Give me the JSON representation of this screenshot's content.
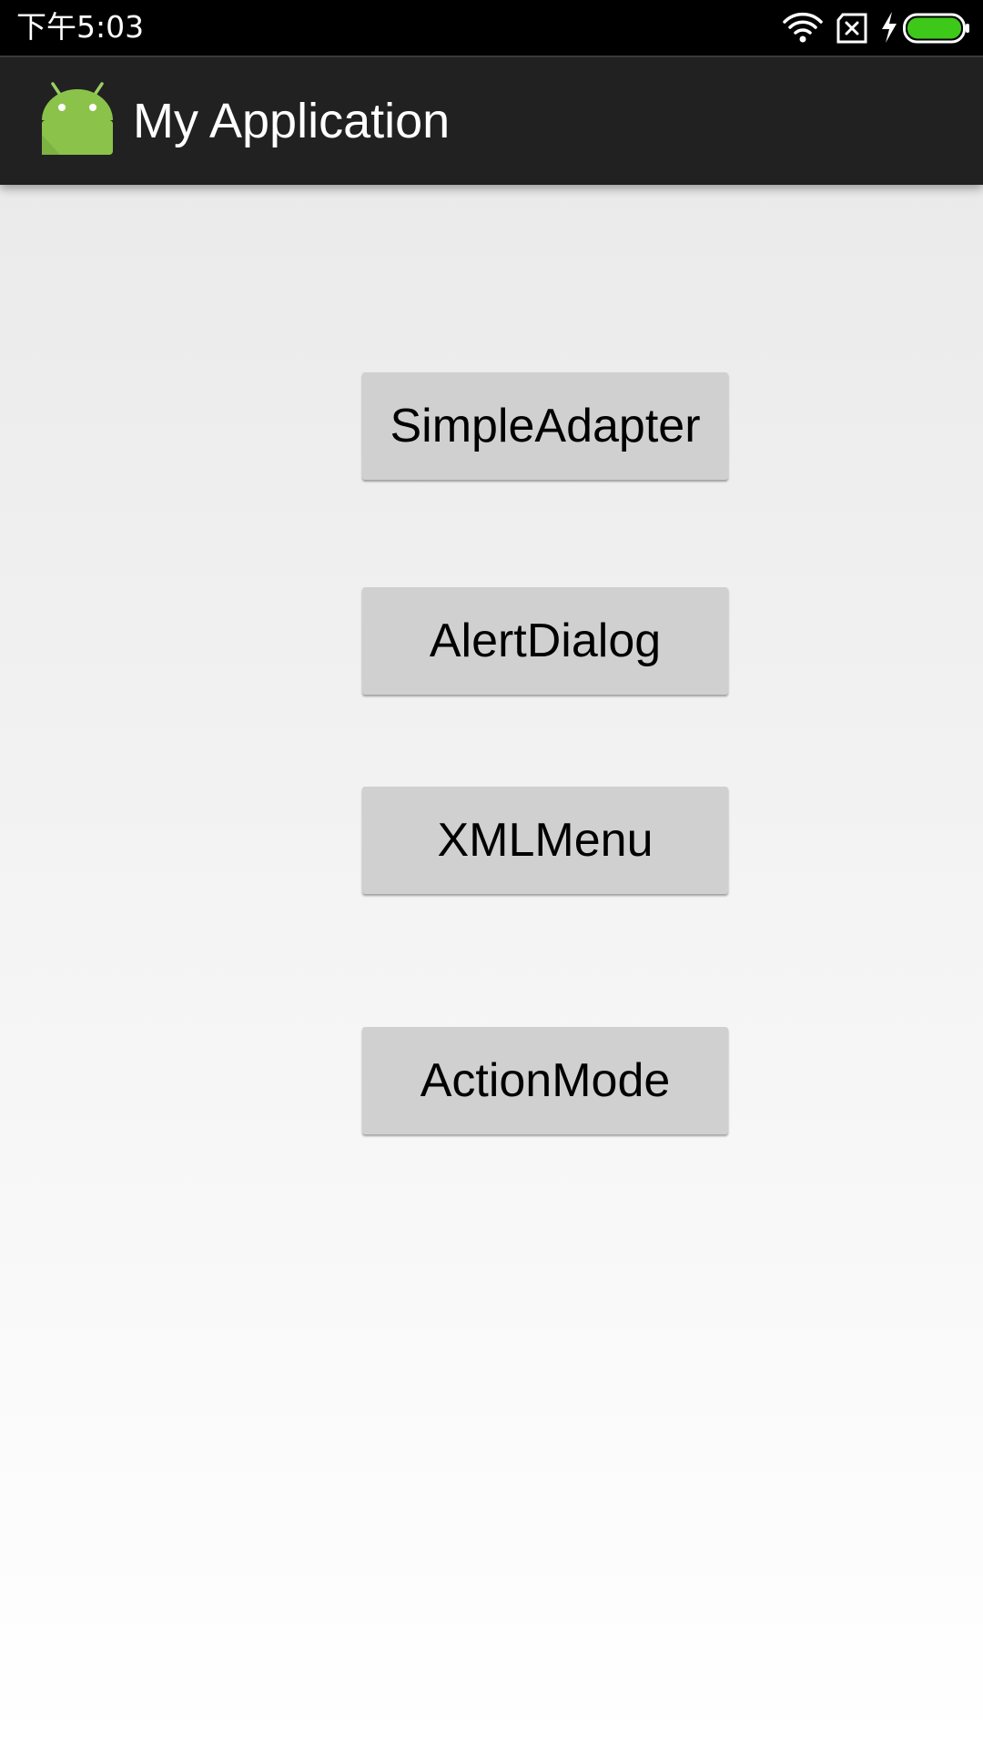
{
  "status_bar": {
    "time": "下午5:03",
    "icons": [
      "wifi-icon",
      "sim-none-icon",
      "charging-icon",
      "battery-full-icon"
    ],
    "battery_color": "#3ec81a"
  },
  "action_bar": {
    "app_icon": "android-icon",
    "title": "My Application",
    "background": "#212121",
    "icon_color": "#8bc34a"
  },
  "buttons": [
    {
      "label": "SimpleAdapter"
    },
    {
      "label": "AlertDialog"
    },
    {
      "label": "XMLMenu"
    },
    {
      "label": "ActionMode"
    }
  ]
}
